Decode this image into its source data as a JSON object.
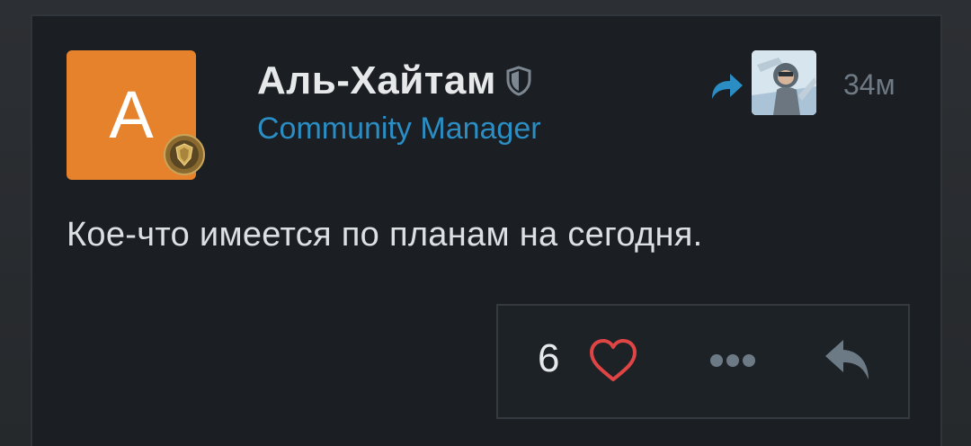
{
  "post": {
    "avatar_letter": "А",
    "author_name": "Аль-Хайтам",
    "author_role": "Community Manager",
    "time": "34м",
    "text": "Кое-что имеется по планам на сегодня.",
    "avatar_color": "#e5822b",
    "role_color": "#2a8ec4"
  },
  "actions": {
    "like_count": "6",
    "like_icon": "heart-icon",
    "more_icon": "more-icon",
    "reply_icon": "reply-icon",
    "heart_color": "#e04545"
  }
}
